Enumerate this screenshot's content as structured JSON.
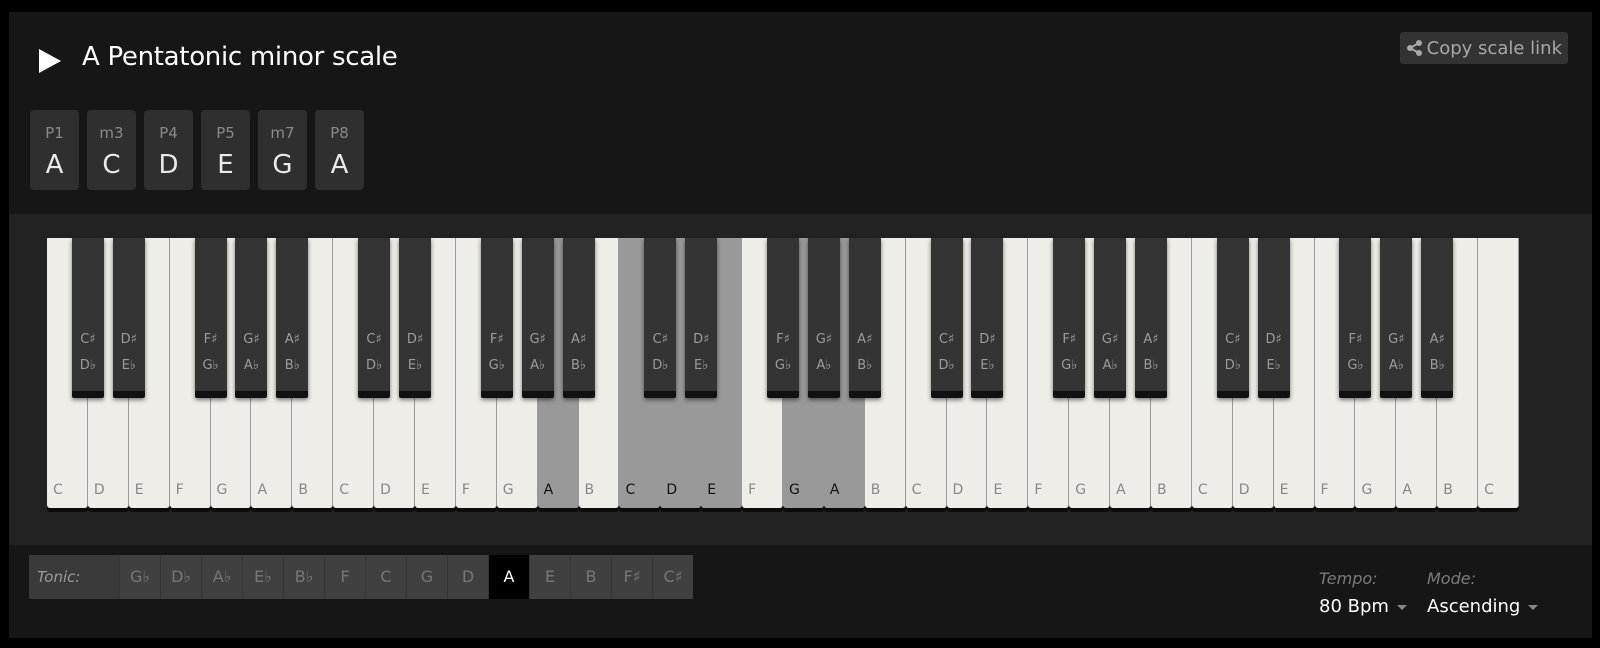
{
  "header": {
    "title": "A Pentatonic minor scale",
    "copy_link_label": "Copy scale link"
  },
  "intervals": [
    {
      "degree": "P1",
      "note": "A"
    },
    {
      "degree": "m3",
      "note": "C"
    },
    {
      "degree": "P4",
      "note": "D"
    },
    {
      "degree": "P5",
      "note": "E"
    },
    {
      "degree": "m7",
      "note": "G"
    },
    {
      "degree": "P8",
      "note": "A"
    }
  ],
  "piano": {
    "octaves": 5,
    "white_notes": [
      "C",
      "D",
      "E",
      "F",
      "G",
      "A",
      "B"
    ],
    "black_keys": [
      {
        "after": 0,
        "sharp": "C♯",
        "flat": "D♭"
      },
      {
        "after": 1,
        "sharp": "D♯",
        "flat": "E♭"
      },
      {
        "after": 3,
        "sharp": "F♯",
        "flat": "G♭"
      },
      {
        "after": 4,
        "sharp": "G♯",
        "flat": "A♭"
      },
      {
        "after": 5,
        "sharp": "A♯",
        "flat": "B♭"
      }
    ],
    "final_note": "C",
    "highlighted_white_indices": [
      12,
      14,
      15,
      16,
      18,
      19
    ],
    "highlight_color": "#999999"
  },
  "footer": {
    "tonic_label": "Tonic:",
    "tonics": [
      "G♭",
      "D♭",
      "A♭",
      "E♭",
      "B♭",
      "F",
      "C",
      "G",
      "D",
      "A",
      "E",
      "B",
      "F♯",
      "C♯"
    ],
    "selected_tonic": "A",
    "tempo_label": "Tempo:",
    "tempo_value": "80 Bpm",
    "mode_label": "Mode:",
    "mode_value": "Ascending"
  }
}
